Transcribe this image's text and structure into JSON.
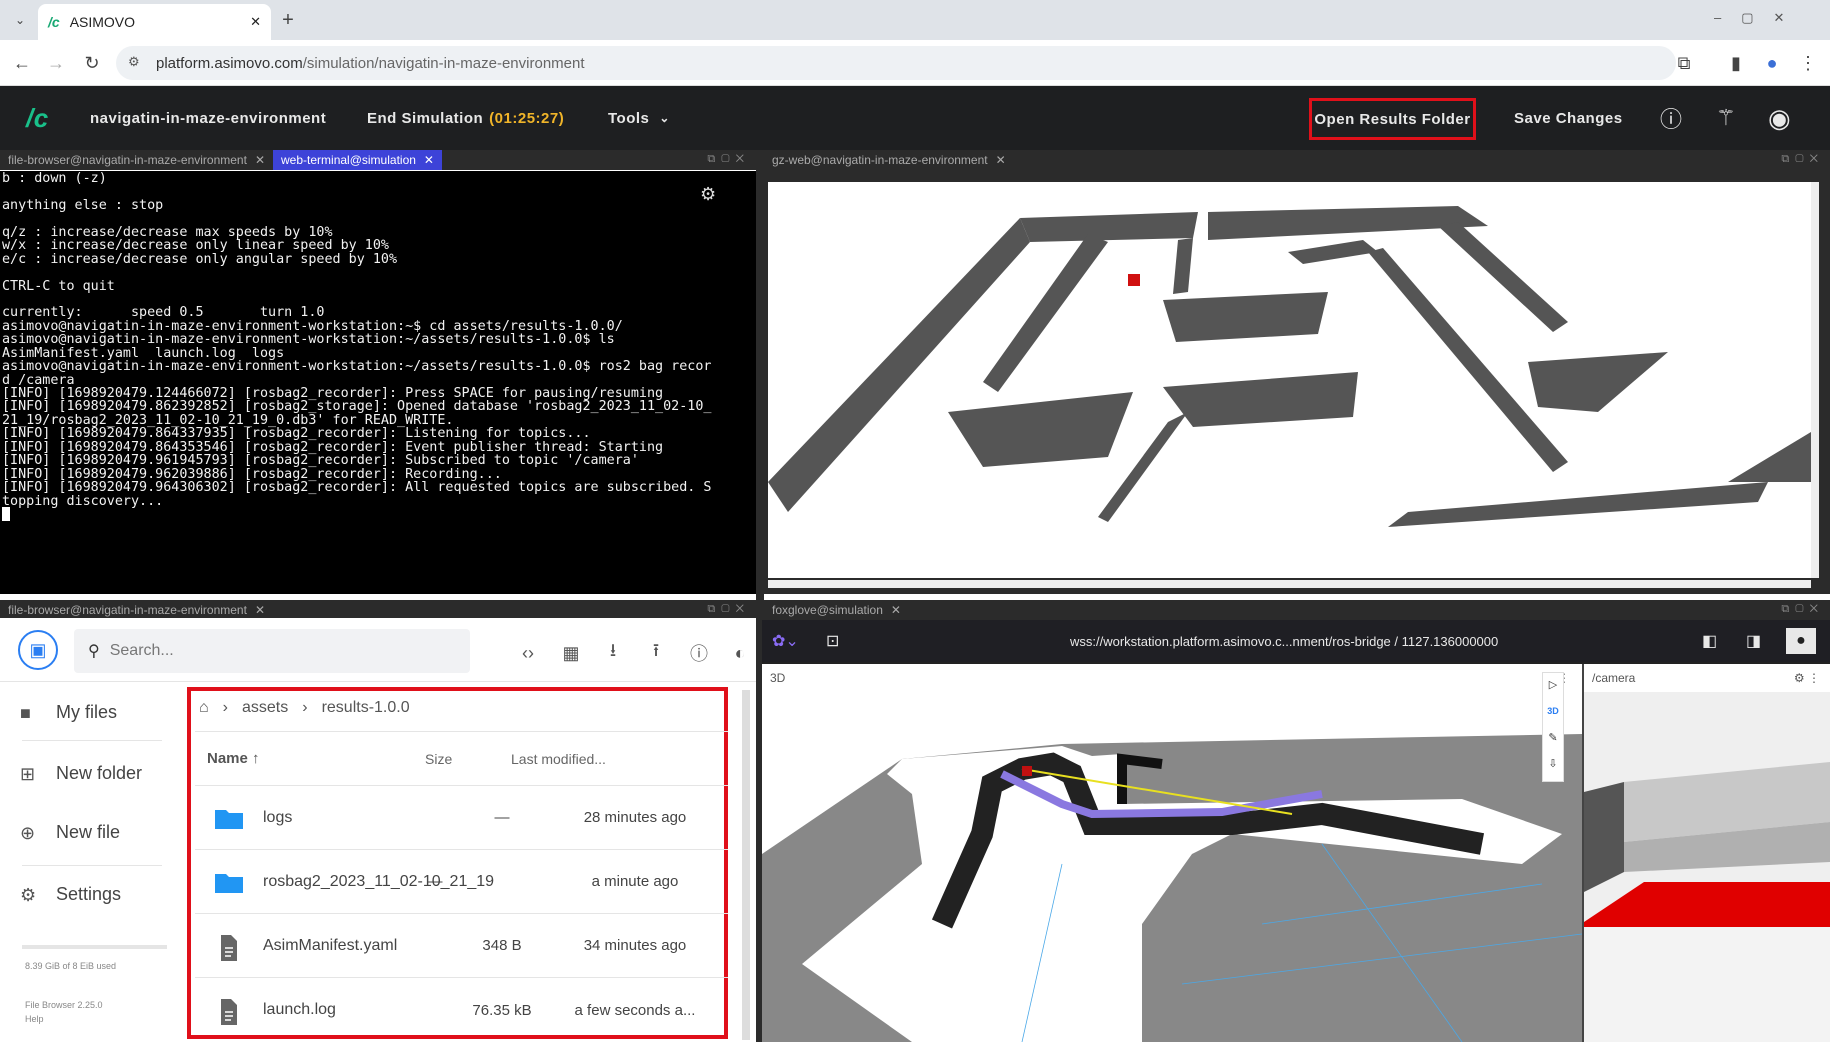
{
  "browser": {
    "tab_title": "ASIMOVO",
    "url_host": "platform.asimovo.com",
    "url_path": "/simulation/navigatin-in-maze-environment"
  },
  "app": {
    "project_name": "navigatin-in-maze-environment",
    "end_simulation_label": "End Simulation",
    "timer": "(01:25:27)",
    "tools_label": "Tools",
    "open_results_label": "Open Results Folder",
    "save_changes_label": "Save Changes",
    "colors": {
      "header_bg": "#1e1f21",
      "accent_orange": "#f0b429",
      "highlight_red": "#e0101a",
      "active_tab": "#3d43d8"
    }
  },
  "terminal_panel": {
    "tabs": [
      "file-browser@navigatin-in-maze-environment",
      "web-terminal@simulation"
    ],
    "lines": [
      "b : down (-z)",
      "",
      "anything else : stop",
      "",
      "q/z : increase/decrease max speeds by 10%",
      "w/x : increase/decrease only linear speed by 10%",
      "e/c : increase/decrease only angular speed by 10%",
      "",
      "CTRL-C to quit",
      "",
      "currently:      speed 0.5       turn 1.0",
      "asimovo@navigatin-in-maze-environment-workstation:~$ cd assets/results-1.0.0/",
      "asimovo@navigatin-in-maze-environment-workstation:~/assets/results-1.0.0$ ls",
      "AsimManifest.yaml  launch.log  logs",
      "asimovo@navigatin-in-maze-environment-workstation:~/assets/results-1.0.0$ ros2 bag recor",
      "d /camera",
      "[INFO] [1698920479.124466072] [rosbag2_recorder]: Press SPACE for pausing/resuming",
      "[INFO] [1698920479.862392852] [rosbag2_storage]: Opened database 'rosbag2_2023_11_02-10_",
      "21_19/rosbag2_2023_11_02-10_21_19_0.db3' for READ_WRITE.",
      "[INFO] [1698920479.864337935] [rosbag2_recorder]: Listening for topics...",
      "[INFO] [1698920479.864353546] [rosbag2_recorder]: Event publisher thread: Starting",
      "[INFO] [1698920479.961945793] [rosbag2_recorder]: Subscribed to topic '/camera'",
      "[INFO] [1698920479.962039886] [rosbag2_recorder]: Recording...",
      "[INFO] [1698920479.964306302] [rosbag2_recorder]: All requested topics are subscribed. S",
      "topping discovery..."
    ]
  },
  "gz_panel": {
    "tab": "gz-web@navigatin-in-maze-environment"
  },
  "file_panel": {
    "tab": "file-browser@navigatin-in-maze-environment",
    "search_placeholder": "Search...",
    "sidebar": [
      {
        "label": "My files",
        "icon": "folder-icon"
      },
      {
        "label": "New folder",
        "icon": "new-folder-icon"
      },
      {
        "label": "New file",
        "icon": "new-file-icon"
      },
      {
        "label": "Settings",
        "icon": "settings-icon"
      }
    ],
    "usage": "8.39 GiB of 8 EiB used",
    "version": "File Browser 2.25.0",
    "help": "Help",
    "breadcrumb": [
      "assets",
      "results-1.0.0"
    ],
    "columns": {
      "name": "Name",
      "size": "Size",
      "modified": "Last modified..."
    },
    "rows": [
      {
        "name": "logs",
        "size": "—",
        "modified": "28 minutes ago",
        "type": "folder"
      },
      {
        "name": "rosbag2_2023_11_02-10_21_19",
        "size": "—",
        "modified": "a minute ago",
        "type": "folder"
      },
      {
        "name": "AsimManifest.yaml",
        "size": "348 B",
        "modified": "34 minutes ago",
        "type": "file"
      },
      {
        "name": "launch.log",
        "size": "76.35 kB",
        "modified": "a few seconds a...",
        "type": "file"
      }
    ]
  },
  "foxglove_panel": {
    "tab": "foxglove@simulation",
    "connection": "wss://workstation.platform.asimovo.c...nment/ros-bridge / 1127.136000000",
    "panel_3d_title": "3D",
    "mode_3d": "3D",
    "camera_title": "/camera"
  }
}
